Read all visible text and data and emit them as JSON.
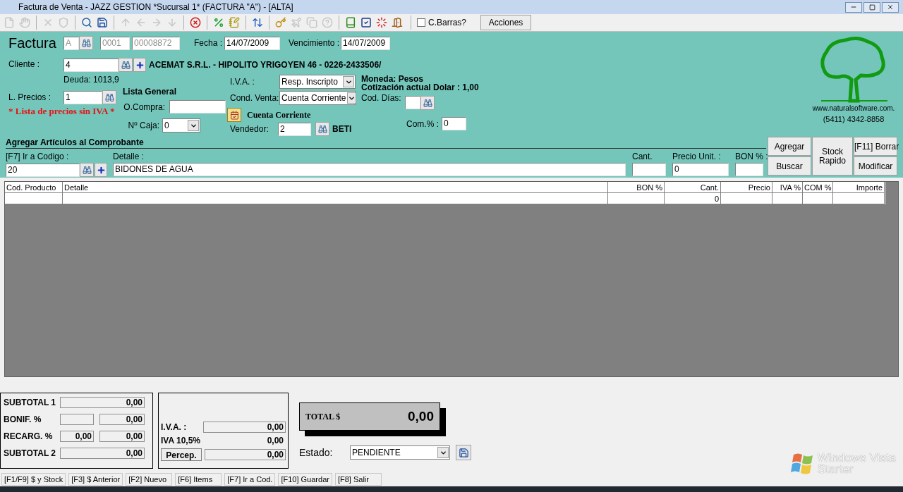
{
  "window": {
    "title": "Factura de Venta - JAZZ GESTION *Sucursal 1* (FACTURA \"A\") - [ALTA]"
  },
  "toolbar": {
    "buttons": [
      {
        "kind": "new",
        "disabled": true
      },
      {
        "kind": "hand",
        "disabled": true
      },
      {
        "kind": "sep"
      },
      {
        "kind": "delete",
        "disabled": true
      },
      {
        "kind": "shield",
        "disabled": true
      },
      {
        "kind": "sep"
      },
      {
        "kind": "search",
        "disabled": false
      },
      {
        "kind": "save",
        "disabled": false
      },
      {
        "kind": "sep"
      },
      {
        "kind": "up",
        "disabled": true
      },
      {
        "kind": "left",
        "disabled": true
      },
      {
        "kind": "right",
        "disabled": true
      },
      {
        "kind": "down",
        "disabled": true
      },
      {
        "kind": "sep"
      },
      {
        "kind": "cancel",
        "disabled": false
      },
      {
        "kind": "sep"
      },
      {
        "kind": "percent",
        "disabled": false
      },
      {
        "kind": "edit",
        "disabled": false
      },
      {
        "kind": "sep"
      },
      {
        "kind": "updown",
        "disabled": false
      },
      {
        "kind": "sep"
      },
      {
        "kind": "key",
        "disabled": false
      },
      {
        "kind": "plane",
        "disabled": true
      },
      {
        "kind": "copy",
        "disabled": true
      },
      {
        "kind": "two",
        "disabled": true
      },
      {
        "kind": "sep"
      },
      {
        "kind": "book",
        "disabled": false
      },
      {
        "kind": "check",
        "disabled": false
      },
      {
        "kind": "ring",
        "disabled": false
      },
      {
        "kind": "exit",
        "disabled": false
      }
    ],
    "barcode": {
      "label": "C.Barras?",
      "checked": false
    },
    "actions": "Acciones"
  },
  "document": {
    "label": "Factura",
    "letter": "A",
    "point_of_sale": "0001",
    "number": "00008872",
    "date_label": "Fecha :",
    "date": "14/07/2009",
    "due_label": "Vencimiento :",
    "due": "14/07/2009"
  },
  "client": {
    "label": "Cliente :",
    "code": "4",
    "name": "ACEMAT S.R.L. - HIPOLITO YRIGOYEN 46 - 0226-2433506/",
    "debt": "Deuda: 1013,9"
  },
  "price_list": {
    "label": "L. Precios :",
    "code": "1",
    "name": "Lista General",
    "note": "* Lista de precios sin IVA *"
  },
  "purchase_order": {
    "label": "O.Compra:"
  },
  "cash_box": {
    "label": "Nº Caja:",
    "value": "0"
  },
  "vat": {
    "label": "I.V.A. :",
    "value": "Resp. Inscripto"
  },
  "sale_condition": {
    "label": "Cond. Venta:",
    "value": "Cuenta Corriente",
    "note": "Cuenta Corriente"
  },
  "seller": {
    "label": "Vendedor:",
    "code": "2",
    "name": "BETI"
  },
  "currency": {
    "text": "Moneda: Pesos",
    "rate": "Cotización actual Dolar : 1,00"
  },
  "days_code": {
    "label": "Cod. Días:"
  },
  "commission": {
    "label": "Com.% :",
    "value": "0"
  },
  "logo": {
    "website": "www.naturalsoftware.com.",
    "phone": "(5411) 4342-8858"
  },
  "add_items": {
    "title": "Agregar Artículos al Comprobante",
    "code_label": "[F7] Ir a Codigo :",
    "code": "20",
    "detail_label": "Detalle :",
    "detail": "BIDONES DE AGUA",
    "qty_label": "Cant.",
    "price_label": "Precio Unit. :",
    "price": "0",
    "bon_label": "BON % :",
    "buttons": {
      "add": "Agregar",
      "search": "Buscar",
      "stock": "Stock Rapido",
      "delete": "[F11] Borrar",
      "modify": "Modificar"
    }
  },
  "table": {
    "columns": [
      "Cod. Producto",
      "Detalle",
      "BON %",
      "Cant.",
      "Precio",
      "IVA %",
      "COM %",
      "Importe"
    ],
    "rows": [
      {
        "qty": "0"
      }
    ]
  },
  "totals": {
    "subtotal1_label": "SUBTOTAL 1",
    "subtotal1": "0,00",
    "bonif_label": "BONIF. %",
    "bonif": "0,00",
    "recarg_label": "RECARG. %",
    "recarg_pct": "0,00",
    "recarg": "0,00",
    "subtotal2_label": "SUBTOTAL 2",
    "subtotal2": "0,00"
  },
  "taxes": {
    "iva_label": "I.V.A. :",
    "iva": "0,00",
    "iva105_label": "IVA 10,5%",
    "iva105": "0,00",
    "percep_button": "Percep.",
    "percep": "0,00"
  },
  "total": {
    "label": "TOTAL $",
    "value": "0,00"
  },
  "status": {
    "label": "Estado:",
    "value": "PENDIENTE"
  },
  "status_bar": [
    "[F1/F9] $ y Stock",
    "[F3] $ Anterior",
    "[F2] Nuevo",
    "[F6] Items",
    "[F7] Ir a Cod.",
    "[F10] Guardar",
    "[F8] Salir"
  ],
  "os_watermark": {
    "line1": "Windows Vista",
    "line2": "Starter"
  }
}
